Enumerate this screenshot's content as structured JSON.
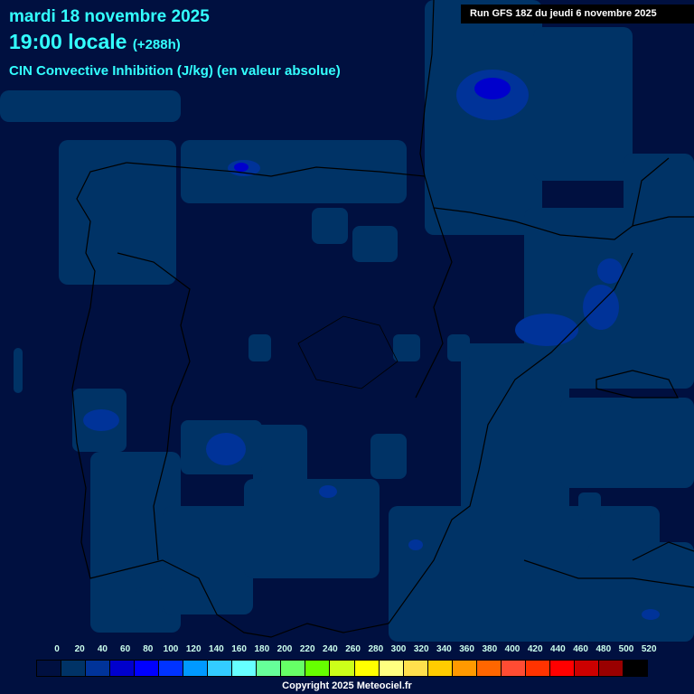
{
  "header": {
    "date": "mardi 18 novembre 2025",
    "time": "19:00 locale",
    "offset": "(+288h)",
    "parameter": "CIN Convective Inhibition (J/kg) (en valeur absolue)"
  },
  "run_info": "Run GFS 18Z du jeudi 6 novembre 2025",
  "legend": {
    "labels": [
      "0",
      "20",
      "40",
      "60",
      "80",
      "100",
      "120",
      "140",
      "160",
      "180",
      "200",
      "220",
      "240",
      "260",
      "280",
      "300",
      "320",
      "340",
      "360",
      "380",
      "400",
      "420",
      "440",
      "460",
      "480",
      "500",
      "520"
    ],
    "colors": [
      "#001040",
      "#003366",
      "#003399",
      "#0000cc",
      "#0000ff",
      "#0033ff",
      "#0099ff",
      "#33ccff",
      "#66ffff",
      "#66ff99",
      "#66ff66",
      "#66ff00",
      "#ccff19",
      "#ffff00",
      "#ffff80",
      "#ffe04d",
      "#ffcc00",
      "#ff9900",
      "#ff6600",
      "#ff4c33",
      "#ff3300",
      "#ff0000",
      "#cc0000",
      "#990000",
      "#660000",
      "#4d0000",
      "#000000"
    ]
  },
  "copyright": "Copyright 2025 Meteociel.fr"
}
